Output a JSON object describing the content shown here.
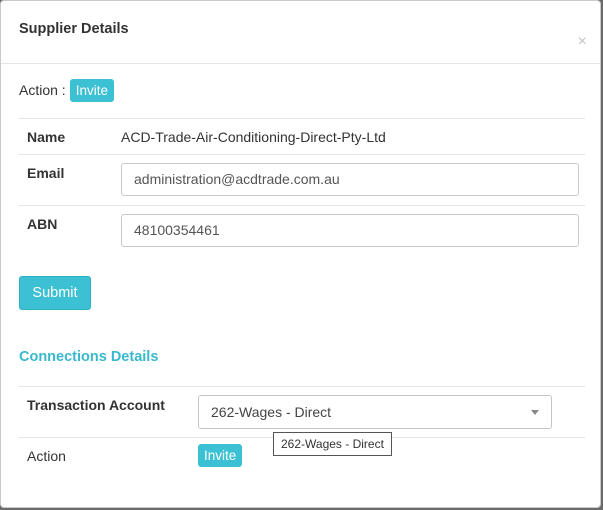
{
  "dialog": {
    "title": "Supplier Details",
    "close_label": "×"
  },
  "action": {
    "label": "Action :",
    "button": "Invite"
  },
  "details": {
    "name_label": "Name",
    "name_value": "ACD-Trade-Air-Conditioning-Direct-Pty-Ltd",
    "email_label": "Email",
    "email_value": "administration@acdtrade.com.au",
    "abn_label": "ABN",
    "abn_value": "48100354461"
  },
  "submit_label": "Submit",
  "connections": {
    "title": "Connections Details",
    "transaction_account_label": "Transaction Account",
    "transaction_account_value": "262-Wages - Direct",
    "tooltip": "262-Wages - Direct",
    "action_label": "Action",
    "action_button": "Invite"
  },
  "colors": {
    "accent": "#3cc0d3"
  }
}
